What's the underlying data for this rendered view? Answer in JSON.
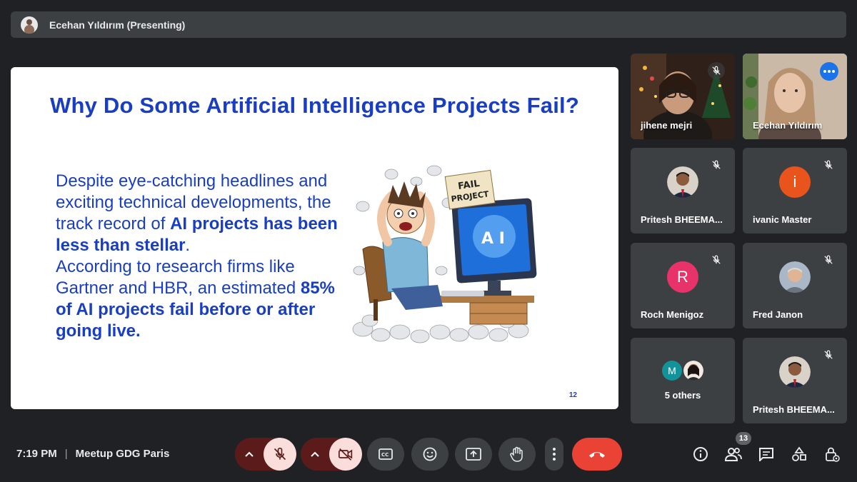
{
  "presenter": {
    "name": "Ecehan Yıldırım (Presenting)"
  },
  "slide": {
    "title": "Why Do Some Artificial Intelligence Projects Fail?",
    "body": {
      "p1": "Despite eye-catching headlines and exciting technical developments, the track record of ",
      "p1_bold": "AI projects has been less than stellar",
      "p1_end": ".",
      "p2": "According to research firms like Gartner and HBR, an estimated ",
      "p2_bold": "85% of AI projects fail before or after going live."
    },
    "illustration": {
      "sign": [
        "FAIL",
        "PROJECT"
      ],
      "screen_text": "A I"
    },
    "page_number": "12"
  },
  "participants": [
    {
      "name": "jihene mejri",
      "type": "video",
      "muted": true
    },
    {
      "name": "Ecehan Yıldırım",
      "type": "video",
      "muted": false,
      "active_speaker": true
    },
    {
      "name": "Pritesh BHEEMA...",
      "type": "photo",
      "muted": true
    },
    {
      "name": "ivanic Master",
      "type": "initial",
      "initial": "i",
      "color": "#e8541c",
      "muted": true
    },
    {
      "name": "Roch Menigoz",
      "type": "initial",
      "initial": "R",
      "color": "#e8336a",
      "muted": true
    },
    {
      "name": "Fred Janon",
      "type": "photo",
      "muted": true
    },
    {
      "name": "5 others",
      "type": "group",
      "initial": "M",
      "color": "#12939a"
    },
    {
      "name": "Pritesh BHEEMA...",
      "type": "photo",
      "muted": true
    }
  ],
  "bottom_bar": {
    "time": "7:19 PM",
    "meeting_name": "Meetup GDG Paris",
    "people_count": "13"
  },
  "colors": {
    "background": "#202124",
    "slide_text": "#1a3ec1",
    "end_call": "#ea4335",
    "muted_control": "#f9dedc",
    "active_border": "#8ab4f8"
  },
  "icons": {
    "controls": [
      "chevron-up-icon",
      "mic-off-icon",
      "chevron-up-icon",
      "camera-off-icon",
      "captions-icon",
      "emoji-icon",
      "present-icon",
      "raise-hand-icon",
      "more-options-icon",
      "end-call-icon"
    ],
    "right": [
      "info-icon",
      "people-icon",
      "chat-icon",
      "activities-icon",
      "host-controls-icon"
    ]
  }
}
